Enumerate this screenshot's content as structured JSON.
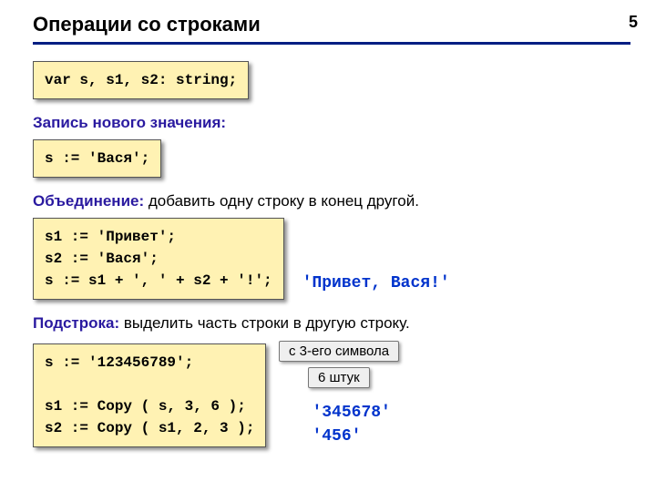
{
  "page_number": "5",
  "title": "Операции со строками",
  "decl_code": "var s, s1, s2: string;",
  "assign": {
    "heading": "Запись нового значения:",
    "code": "s := 'Вася';"
  },
  "concat": {
    "heading_key": "Объединение:",
    "heading_rest": " добавить одну строку в конец другой.",
    "code": "s1 := 'Привет';\ns2 := 'Вася';\ns := s1 + ', ' + s2 + '!';",
    "result": "'Привет, Вася!'"
  },
  "substr": {
    "heading_key": "Подстрока:",
    "heading_rest": " выделить часть строки в другую строку.",
    "code": "s := '123456789';\n\ns1 := Copy ( s, 3, 6 );\ns2 := Copy ( s1, 2, 3 );",
    "anno1": "с 3-его символа",
    "anno2": "6 штук",
    "result1": "'345678'",
    "result2": "'456'"
  }
}
